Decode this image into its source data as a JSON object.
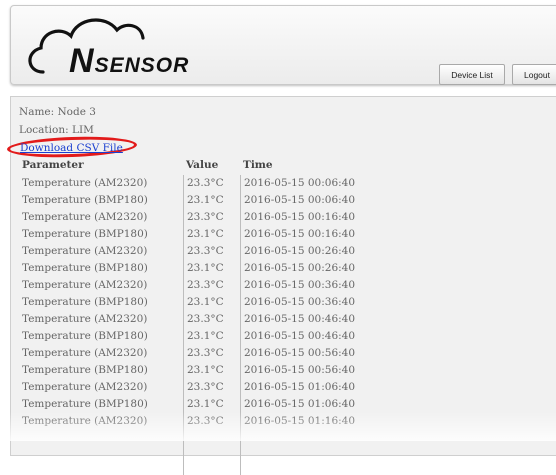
{
  "header": {
    "logo_letter": "N",
    "logo_rest": "SENSOR",
    "device_list_label": "Device List",
    "logout_label": "Logout"
  },
  "node": {
    "name": "Name: Node 3",
    "location": "Location: LIM",
    "download_label": "Download CSV File"
  },
  "table": {
    "headers": {
      "parameter": "Parameter",
      "value": "Value",
      "time": "Time"
    },
    "rows": [
      {
        "parameter": "Temperature (AM2320)",
        "value": "23.3°C",
        "time": "2016-05-15 00:06:40"
      },
      {
        "parameter": "Temperature (BMP180)",
        "value": "23.1°C",
        "time": "2016-05-15 00:06:40"
      },
      {
        "parameter": "Temperature (AM2320)",
        "value": "23.3°C",
        "time": "2016-05-15 00:16:40"
      },
      {
        "parameter": "Temperature (BMP180)",
        "value": "23.1°C",
        "time": "2016-05-15 00:16:40"
      },
      {
        "parameter": "Temperature (AM2320)",
        "value": "23.3°C",
        "time": "2016-05-15 00:26:40"
      },
      {
        "parameter": "Temperature (BMP180)",
        "value": "23.1°C",
        "time": "2016-05-15 00:26:40"
      },
      {
        "parameter": "Temperature (AM2320)",
        "value": "23.3°C",
        "time": "2016-05-15 00:36:40"
      },
      {
        "parameter": "Temperature (BMP180)",
        "value": "23.1°C",
        "time": "2016-05-15 00:36:40"
      },
      {
        "parameter": "Temperature (AM2320)",
        "value": "23.3°C",
        "time": "2016-05-15 00:46:40"
      },
      {
        "parameter": "Temperature (BMP180)",
        "value": "23.1°C",
        "time": "2016-05-15 00:46:40"
      },
      {
        "parameter": "Temperature (AM2320)",
        "value": "23.3°C",
        "time": "2016-05-15 00:56:40"
      },
      {
        "parameter": "Temperature (BMP180)",
        "value": "23.1°C",
        "time": "2016-05-15 00:56:40"
      },
      {
        "parameter": "Temperature (AM2320)",
        "value": "23.3°C",
        "time": "2016-05-15 01:06:40"
      },
      {
        "parameter": "Temperature (BMP180)",
        "value": "23.1°C",
        "time": "2016-05-15 01:06:40"
      },
      {
        "parameter": "Temperature (AM2320)",
        "value": "23.3°C",
        "time": "2016-05-15 01:16:40"
      }
    ]
  },
  "colors": {
    "link": "#1a3fd0",
    "highlight_circle": "#e21b1b",
    "panel_bg": "#f1f1f1"
  }
}
